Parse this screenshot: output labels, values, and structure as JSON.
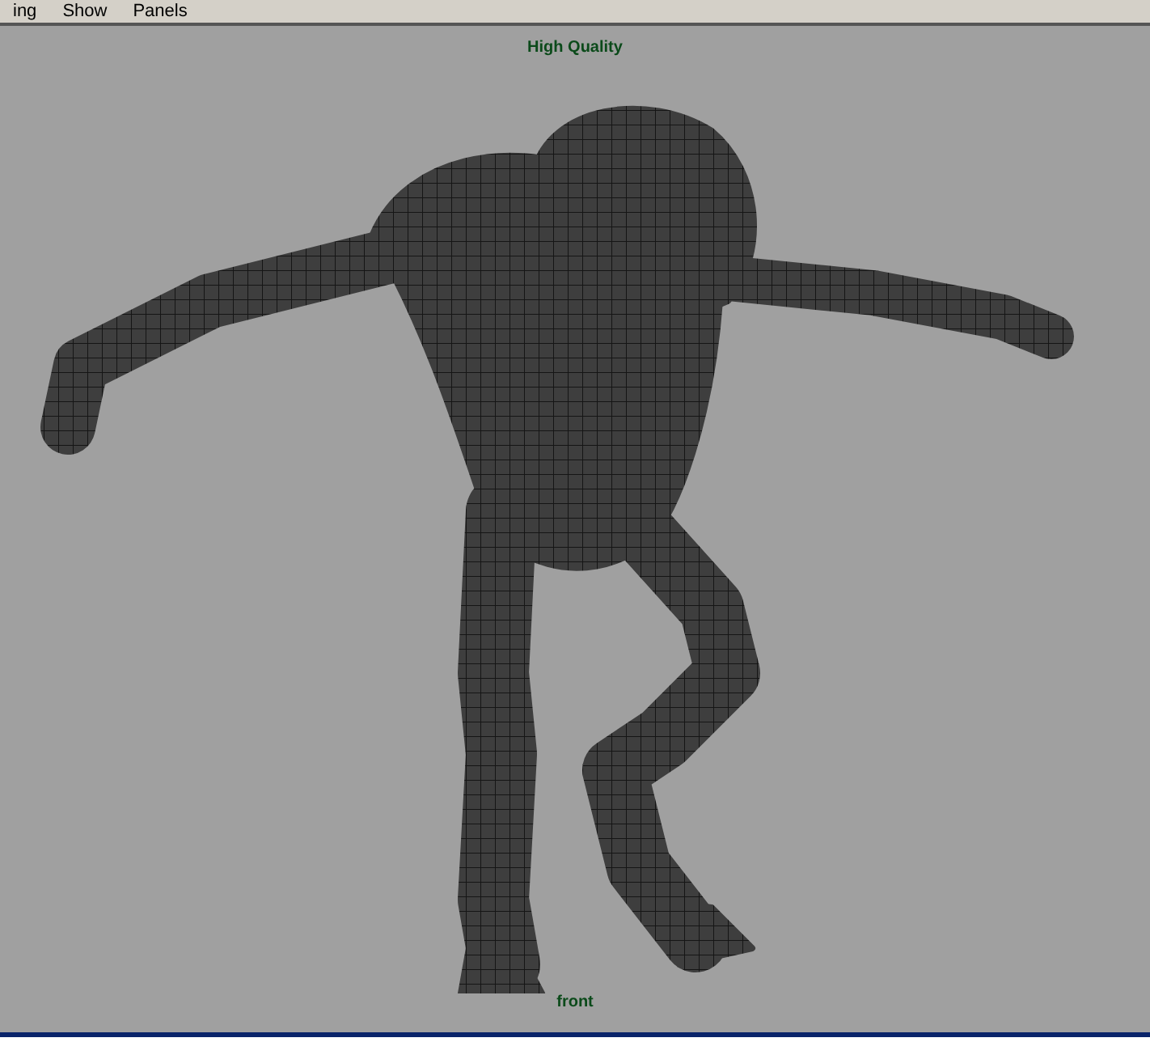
{
  "menu_bar": {
    "items": [
      "ing",
      "Show",
      "Panels"
    ]
  },
  "viewport": {
    "quality_label": "High Quality",
    "camera_label": "front"
  }
}
